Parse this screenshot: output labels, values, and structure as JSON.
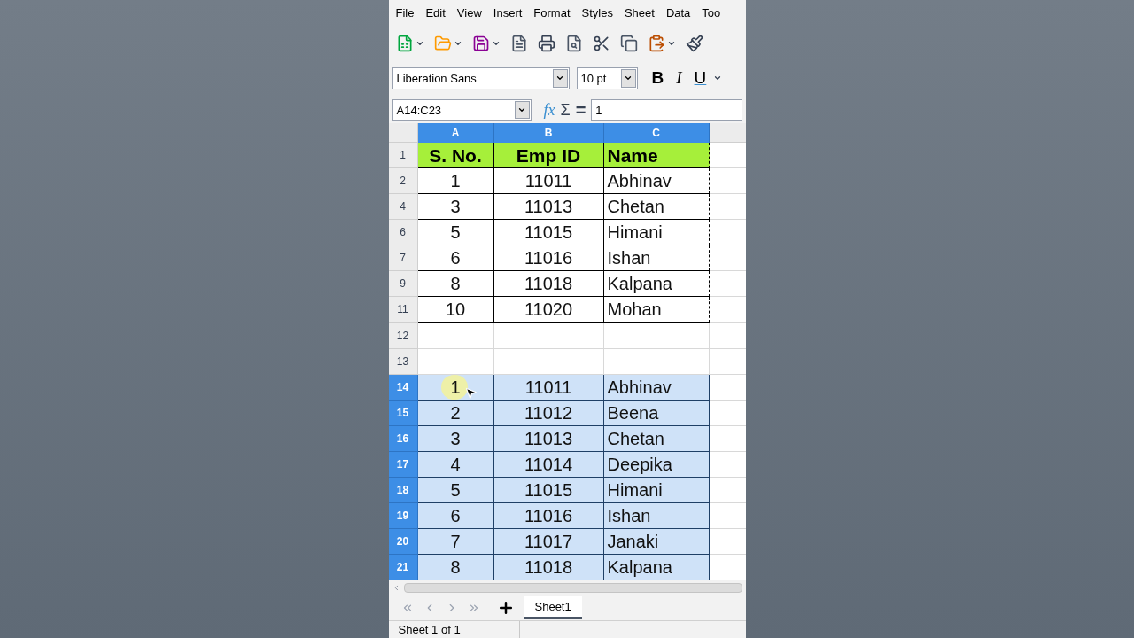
{
  "menu": [
    "File",
    "Edit",
    "View",
    "Insert",
    "Format",
    "Styles",
    "Sheet",
    "Data",
    "Too"
  ],
  "formatting": {
    "font_name": "Liberation Sans",
    "font_size": "10 pt",
    "style_buttons": [
      "B",
      "I",
      "U"
    ]
  },
  "formula_bar": {
    "name_box": "A14:C23",
    "symbols": [
      "fx",
      "Σ",
      "="
    ],
    "content": "1"
  },
  "columns": [
    {
      "label": "A",
      "selected": true
    },
    {
      "label": "B",
      "selected": true
    },
    {
      "label": "C",
      "selected": true
    }
  ],
  "rows": [
    {
      "number": "1",
      "kind": "header",
      "selected": false,
      "marquee": true,
      "cells": [
        "S. No.",
        "Emp ID",
        "Name"
      ]
    },
    {
      "number": "2",
      "kind": "data",
      "selected": false,
      "marquee": true,
      "cells": [
        "1",
        "11011",
        "Abhinav"
      ]
    },
    {
      "number": "4",
      "kind": "data",
      "selected": false,
      "marquee": true,
      "cells": [
        "3",
        "11013",
        "Chetan"
      ]
    },
    {
      "number": "6",
      "kind": "data",
      "selected": false,
      "marquee": true,
      "cells": [
        "5",
        "11015",
        "Himani"
      ]
    },
    {
      "number": "7",
      "kind": "data",
      "selected": false,
      "marquee": true,
      "cells": [
        "6",
        "11016",
        "Ishan"
      ]
    },
    {
      "number": "9",
      "kind": "data",
      "selected": false,
      "marquee": true,
      "cells": [
        "8",
        "11018",
        "Kalpana"
      ]
    },
    {
      "number": "11",
      "kind": "data",
      "selected": false,
      "marquee": true,
      "cells": [
        "10",
        "11020",
        "Mohan"
      ]
    },
    {
      "number": "12",
      "kind": "empty",
      "selected": false,
      "marquee": false,
      "cells": []
    },
    {
      "number": "13",
      "kind": "empty",
      "selected": false,
      "marquee": false,
      "cells": []
    },
    {
      "number": "14",
      "kind": "data",
      "selected": true,
      "marquee": false,
      "cells": [
        "1",
        "11011",
        "Abhinav"
      ]
    },
    {
      "number": "15",
      "kind": "data",
      "selected": true,
      "marquee": false,
      "cells": [
        "2",
        "11012",
        "Beena"
      ]
    },
    {
      "number": "16",
      "kind": "data",
      "selected": true,
      "marquee": false,
      "cells": [
        "3",
        "11013",
        "Chetan"
      ]
    },
    {
      "number": "17",
      "kind": "data",
      "selected": true,
      "marquee": false,
      "cells": [
        "4",
        "11014",
        "Deepika"
      ]
    },
    {
      "number": "18",
      "kind": "data",
      "selected": true,
      "marquee": false,
      "cells": [
        "5",
        "11015",
        "Himani"
      ]
    },
    {
      "number": "19",
      "kind": "data",
      "selected": true,
      "marquee": false,
      "cells": [
        "6",
        "11016",
        "Ishan"
      ]
    },
    {
      "number": "20",
      "kind": "data",
      "selected": true,
      "marquee": false,
      "cells": [
        "7",
        "11017",
        "Janaki"
      ]
    },
    {
      "number": "21",
      "kind": "data",
      "selected": true,
      "marquee": false,
      "cells": [
        "8",
        "11018",
        "Kalpana"
      ]
    }
  ],
  "sheet_tabs": [
    {
      "label": "Sheet1",
      "selected": true
    }
  ],
  "status_bar": "Sheet 1 of 1"
}
